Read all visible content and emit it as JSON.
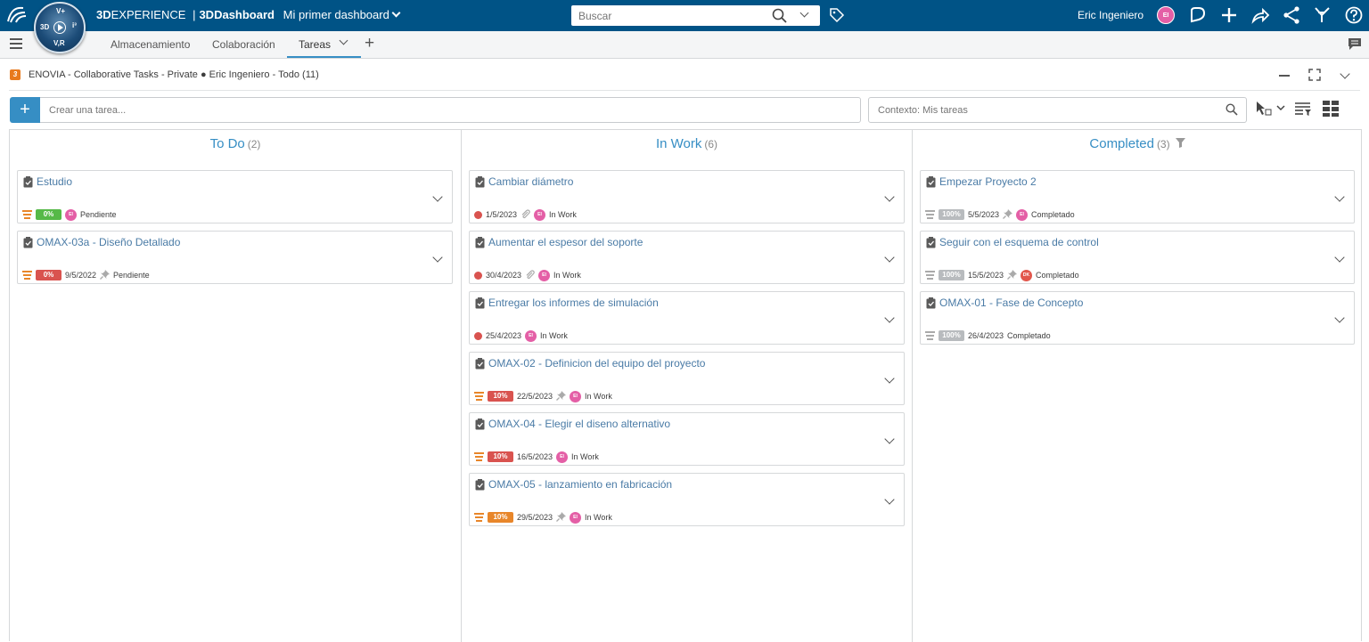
{
  "topbar": {
    "brand_prefix": "3D",
    "brand_experience": "EXPERIENCE",
    "brand_sep": "|",
    "brand_app": "3DDashboard",
    "dashboard_name": "Mi primer dashboard",
    "search_placeholder": "Buscar",
    "user_name": "Eric Ingeniero",
    "user_initials": "EI",
    "compass_labels": {
      "top": "V+",
      "left": "3D",
      "right": "i³",
      "bottom": "V,R"
    }
  },
  "tabs": {
    "items": [
      {
        "label": "Almacenamiento"
      },
      {
        "label": "Colaboración"
      },
      {
        "label": "Tareas"
      }
    ]
  },
  "widget": {
    "title": "ENOVIA - Collaborative Tasks - Private ● Eric Ingeniero - Todo (11)"
  },
  "toolbar": {
    "create_placeholder": "Crear una tarea...",
    "context_placeholder": "Contexto: Mis tareas"
  },
  "colors": {
    "brand_bar": "#005386",
    "accent": "#368ec4",
    "status_green": "#56b948",
    "status_red": "#d9534f",
    "status_orange": "#e8862a",
    "status_grey": "#b8bbbe",
    "avatar_pink": "#e45fa6"
  },
  "columns": [
    {
      "title": "To Do",
      "count": "(2)",
      "cards": [
        {
          "title": "Estudio",
          "badge": "0%",
          "badge_color": "#56b948",
          "date": "",
          "owner": "EI",
          "status": "Pendiente",
          "show_prio": true,
          "show_dot": false,
          "show_clip": false,
          "show_pin": false
        },
        {
          "title": "OMAX-03a - Diseño Detallado",
          "badge": "0%",
          "badge_color": "#d9534f",
          "date": "9/5/2022",
          "owner": "",
          "status": "Pendiente",
          "show_prio": true,
          "show_dot": false,
          "show_clip": false,
          "show_pin": true
        }
      ]
    },
    {
      "title": "In Work",
      "count": "(6)",
      "cards": [
        {
          "title": "Cambiar diámetro",
          "badge": "",
          "date": "1/5/2023",
          "owner": "EI",
          "status": "In Work",
          "show_prio": false,
          "show_dot": true,
          "show_clip": true,
          "show_pin": false
        },
        {
          "title": "Aumentar el espesor del soporte",
          "badge": "",
          "date": "30/4/2023",
          "owner": "EI",
          "status": "In Work",
          "show_prio": false,
          "show_dot": true,
          "show_clip": true,
          "show_pin": false
        },
        {
          "title": "Entregar los informes de simulación",
          "badge": "",
          "date": "25/4/2023",
          "owner": "EI",
          "status": "In Work",
          "show_prio": false,
          "show_dot": true,
          "show_clip": false,
          "show_pin": false
        },
        {
          "title": "OMAX-02 - Definicion del equipo del proyecto",
          "badge": "10%",
          "badge_color": "#d9534f",
          "date": "22/5/2023",
          "owner": "EI",
          "status": "In Work",
          "show_prio": true,
          "show_dot": false,
          "show_clip": false,
          "show_pin": true
        },
        {
          "title": "OMAX-04 - Elegir el diseno alternativo",
          "badge": "10%",
          "badge_color": "#d9534f",
          "date": "16/5/2023",
          "owner": "EI",
          "status": "In Work",
          "show_prio": true,
          "show_dot": false,
          "show_clip": false,
          "show_pin": false
        },
        {
          "title": "OMAX-05 - lanzamiento en fabricación",
          "badge": "10%",
          "badge_color": "#e8862a",
          "date": "29/5/2023",
          "owner": "EI",
          "status": "In Work",
          "show_prio": true,
          "show_dot": false,
          "show_clip": false,
          "show_pin": true
        }
      ]
    },
    {
      "title": "Completed",
      "count": "(3)",
      "cards": [
        {
          "title": "Empezar Proyecto 2",
          "badge": "100%",
          "badge_color": "#b8bbbe",
          "date": "5/5/2023",
          "owner": "EI",
          "status": "Completado",
          "show_prio": true,
          "show_dot": false,
          "show_clip": false,
          "show_pin": true
        },
        {
          "title": "Seguir con el esquema de control",
          "badge": "100%",
          "badge_color": "#b8bbbe",
          "date": "15/5/2023",
          "owner": "DK",
          "status": "Completado",
          "show_prio": true,
          "show_dot": false,
          "show_clip": false,
          "show_pin": true
        },
        {
          "title": "OMAX-01 - Fase de Concepto",
          "badge": "100%",
          "badge_color": "#b8bbbe",
          "date": "26/4/2023",
          "owner": "",
          "status": "Completado",
          "show_prio": true,
          "show_dot": false,
          "show_clip": false,
          "show_pin": false
        }
      ]
    }
  ]
}
